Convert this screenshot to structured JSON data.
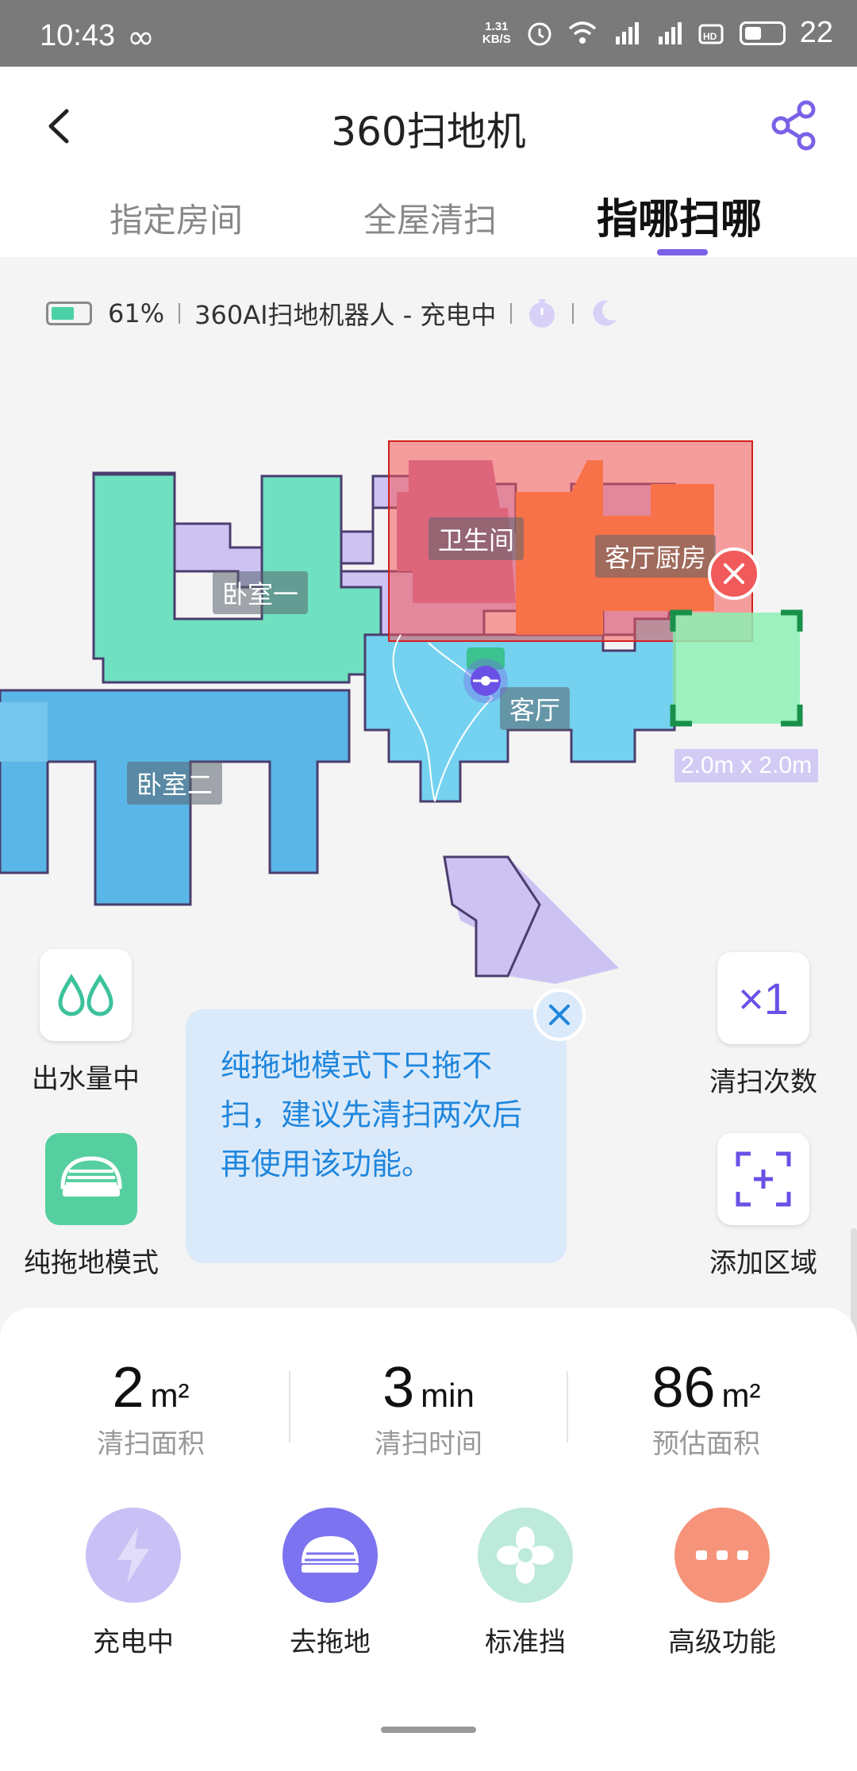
{
  "status_bar": {
    "time": "10:43",
    "net_speed_value": "1.31",
    "net_speed_unit": "KB/S",
    "battery_level": "22"
  },
  "header": {
    "title": "360扫地机",
    "tabs": [
      {
        "label": "指定房间"
      },
      {
        "label": "全屋清扫"
      },
      {
        "label": "指哪扫哪"
      }
    ],
    "active_tab": 2
  },
  "device": {
    "battery_pct": "61%",
    "status": "360AI扫地机器人 - 充电中"
  },
  "map": {
    "rooms": [
      {
        "label": "卫生间"
      },
      {
        "label": "客厅厨房"
      },
      {
        "label": "卧室一"
      },
      {
        "label": "客厅"
      },
      {
        "label": "卧室二"
      }
    ],
    "zone_size": "2.0m x 2.0m"
  },
  "controls": {
    "water": {
      "label": "出水量中"
    },
    "mop_mode": {
      "label": "纯拖地模式"
    },
    "clean_times": {
      "value": "×1",
      "label": "清扫次数"
    },
    "add_area": {
      "label": "添加区域"
    }
  },
  "tip": {
    "text": "纯拖地模式下只拖不扫，建议先清扫两次后再使用该功能。"
  },
  "stats": [
    {
      "value": "2",
      "unit": "m²",
      "label": "清扫面积"
    },
    {
      "value": "3",
      "unit": "min",
      "label": "清扫时间"
    },
    {
      "value": "86",
      "unit": "m²",
      "label": "预估面积"
    }
  ],
  "actions": [
    {
      "label": "充电中",
      "color": "#c9c1f5"
    },
    {
      "label": "去拖地",
      "color": "#7b73ef"
    },
    {
      "label": "标准挡",
      "color": "#bdeadb"
    },
    {
      "label": "高级功能",
      "color": "#f5947a"
    }
  ]
}
